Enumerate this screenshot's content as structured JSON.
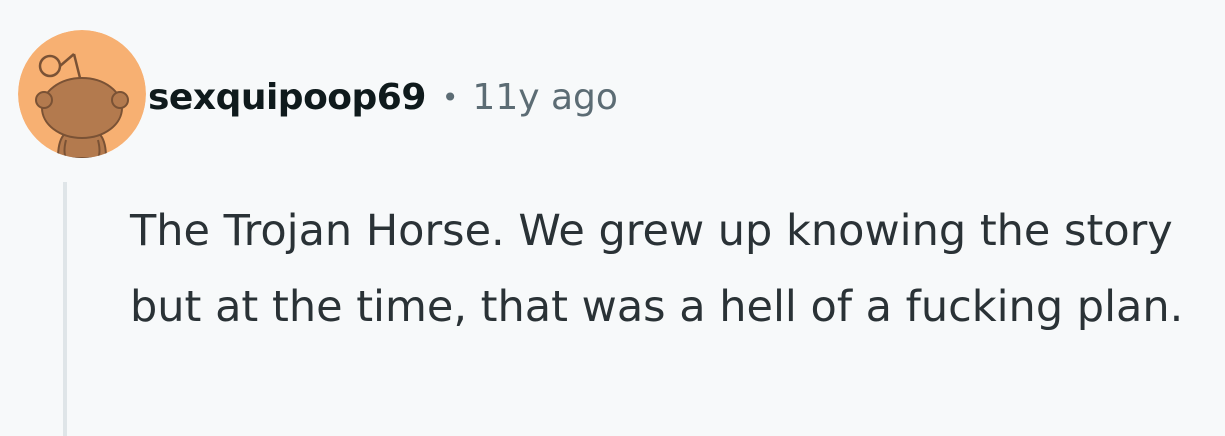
{
  "comment": {
    "author": "sexquipoop69",
    "separator": "•",
    "timestamp": "11y ago",
    "body": "The Trojan Horse. We grew up knowing the story but at the time, that was a hell of a fucking plan.",
    "avatar": {
      "icon": "snoo-avatar-icon",
      "background_color": "#f7b072",
      "figure_color": "#b37a4e",
      "outline_color": "#7a5235"
    }
  }
}
